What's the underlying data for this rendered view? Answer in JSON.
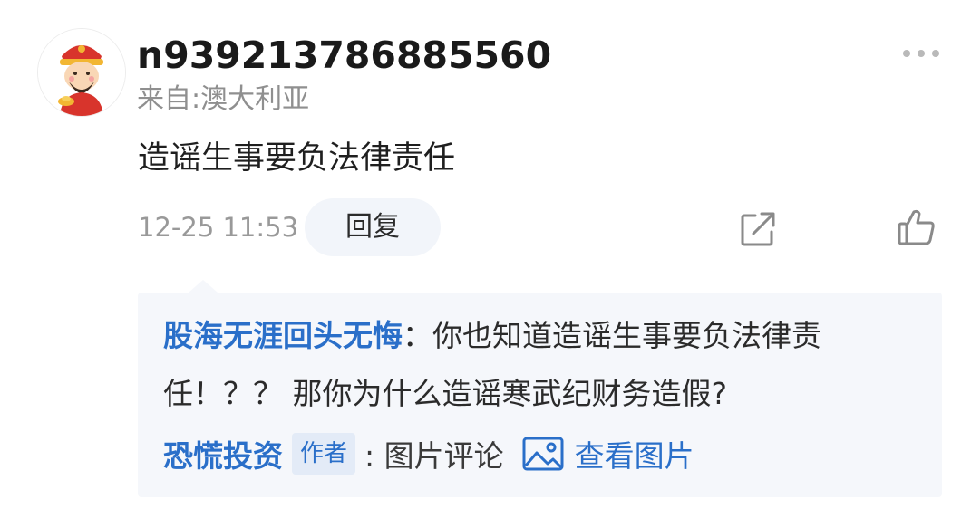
{
  "comment": {
    "username": "n939213786885560",
    "location": "来自:澳大利亚",
    "text": "造谣生事要负法律责任",
    "timestamp": "12-25 11:53",
    "reply_label": "回复",
    "avatar_icon": "fortune-god-avatar",
    "more_icon": "more-dots-icon",
    "share_icon": "share-icon",
    "like_icon": "thumbs-up-icon"
  },
  "reply_box": {
    "reply_author": "股海无涯回头无悔",
    "reply_separator": "：",
    "reply_text_line1": "你也知道造谣生事要负法律责",
    "reply_text_line2": "任！？？ 那你为什么造谣寒武纪财务造假?",
    "author_name": "恐慌投资",
    "author_badge": "作者",
    "comment_type": ": 图片评论",
    "image_icon": "image-icon",
    "view_image_label": "查看图片"
  },
  "colors": {
    "link_blue": "#2a6fc9",
    "reply_bg": "#f5f7fb",
    "muted_gray": "#8f8f8f"
  }
}
